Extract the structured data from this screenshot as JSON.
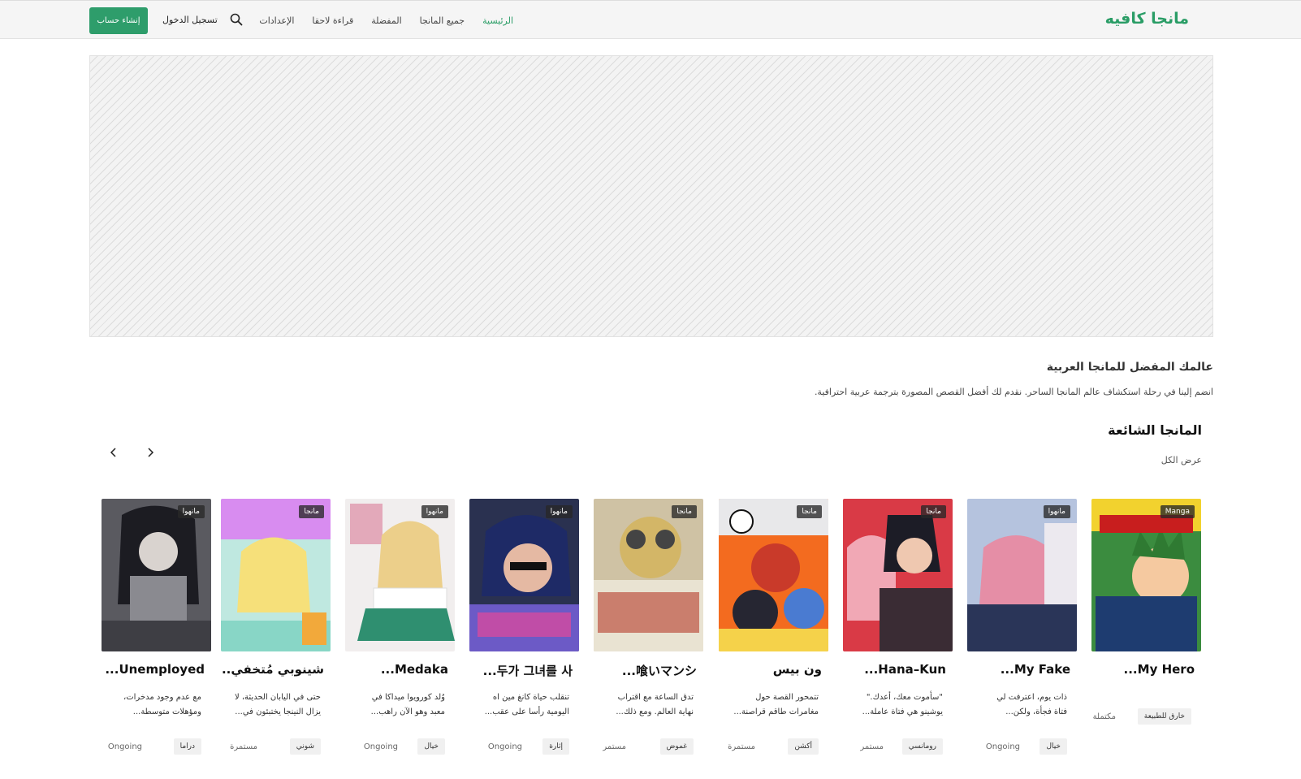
{
  "header": {
    "logo": "مانجا كافيه",
    "nav": [
      {
        "label": "الرئيسية",
        "active": true
      },
      {
        "label": "جميع المانجا",
        "active": false
      },
      {
        "label": "المفضلة",
        "active": false
      },
      {
        "label": "قراءة لاحقا",
        "active": false
      },
      {
        "label": "الإعدادات",
        "active": false
      }
    ],
    "login": "تسجيل الدخول",
    "signup": "إنشاء حساب"
  },
  "intro": {
    "title": "عالمك المفضل للمانجا العربية",
    "text": "انضم إلينا في رحلة استكشاف عالم المانجا الساحر. نقدم لك أفضل القصص المصورة بترجمة عربية احترافية."
  },
  "section": {
    "title": "المانجا الشائعة",
    "view_all": "عرض الكل"
  },
  "colors": {
    "accent": "#2a9d66",
    "signup_bg": "#2e9d6b"
  },
  "cards": [
    {
      "badge": "Manga",
      "title": "My Hero...",
      "desc1": "",
      "desc2": "",
      "genre": "خارق للطبيعة",
      "status": "مكتملة"
    },
    {
      "badge": "مانهوا",
      "title": "My Fake...",
      "desc1": "ذات يوم، اعترفت لي",
      "desc2": "فتاة فجأة، ولكن...",
      "genre": "خيال",
      "status": "Ongoing"
    },
    {
      "badge": "مانجا",
      "title": "Hana–Kun...",
      "desc1": "\"سأموت معك، أعدك.\"",
      "desc2": "يوشينو هي فتاة عاملة...",
      "genre": "رومانسي",
      "status": "مستمر"
    },
    {
      "badge": "مانجا",
      "title": "ون بيس",
      "desc1": "تتمحور القصة حول",
      "desc2": "مغامرات طاقم قراصنة...",
      "genre": "أكشن",
      "status": "مستمرة"
    },
    {
      "badge": "مانجا",
      "title": "喰いマンシ...",
      "desc1": "تدق الساعة مع اقتراب",
      "desc2": "نهاية العالم. ومع ذلك...",
      "genre": "غموض",
      "status": "مستمر"
    },
    {
      "badge": "مانهوا",
      "title": "두가 그녀를 사...",
      "desc1": "تنقلب حياة كانغ مين اه",
      "desc2": "اليومية رأسا على عقب...",
      "genre": "إثارة",
      "status": "Ongoing"
    },
    {
      "badge": "مانهوا",
      "title": "Medaka...",
      "desc1": "وُلد كورويوا ميداكا في",
      "desc2": "معبد وهو الآن راهب...",
      "genre": "خيال",
      "status": "Ongoing"
    },
    {
      "badge": "مانجا",
      "title": "شينوبي مُتخفي...",
      "desc1": "حتى في اليابان الحديثة، لا",
      "desc2": "يزال النينجا يختبئون في...",
      "genre": "شوني",
      "status": "مستمرة"
    },
    {
      "badge": "مانهوا",
      "title": "Unemployed...",
      "desc1": "مع عدم وجود مدخرات،",
      "desc2": "ومؤهلات متوسطة...",
      "genre": "دراما",
      "status": "Ongoing"
    }
  ]
}
